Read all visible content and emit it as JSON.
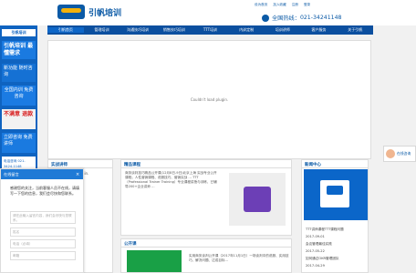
{
  "brand": {
    "logo_en": "SAILING",
    "logo_cn": "引帆培训"
  },
  "toplinks": [
    "设为首页",
    "加入收藏",
    "注册",
    "登录"
  ],
  "hotline": {
    "label": "全国热线：",
    "number": "021-34241148"
  },
  "nav": {
    "items": [
      "引帆首页",
      "管理培训",
      "沟通技巧培训",
      "销售技巧培训",
      "TTT培训",
      "内训定制",
      "培训讲师",
      "客户服务",
      "关于引帆"
    ],
    "active_index": 0
  },
  "left_rail": {
    "title": "引帆培训",
    "a": "引帆培训 最懂需求",
    "b": "新功能 随时咨询",
    "c": "全国内训 免费咨询",
    "d": "不满意 退款",
    "e": "立即咨询 免费讲师",
    "f": "电话咨询 021-3424-1148"
  },
  "main_plugin": {
    "message": "Couldn't load plugin."
  },
  "panels": {
    "p1": {
      "title": "实战讲师",
      "text": "Couldn't load plugin."
    },
    "p2": {
      "title": "精品课程",
      "text": "商务谈判技巧精品公开课(12月8日-9日)北京上海  实战专业公开课程；人性营销课程、说服技巧、营销实战 …  TTT（Professional Trainer Training）专业课程讲授与训练，已辅导200+企业讲师 …"
    },
    "p3": {
      "title": "公开课",
      "text": "实用商务谈判公开课（2017年11月1日）一场谈判中的说服、实用技巧、解决问题、达成目标…"
    },
    "p4": {
      "title": "新闻中心",
      "list": [
        "TTT讲师课程TTT课程问题",
        "2017-09-01",
        "会议管理最佳实践",
        "2017-05-22",
        "如何通过OKR管理团队",
        "2017-04-29"
      ]
    }
  },
  "chat": {
    "header": "在线留言",
    "message": "感谢您的关注，当前客服人员不在线，请填写一下您的信息，我们会尽快和您联系。",
    "input_placeholder": "请在此输入留言内容，我们会尽快与您联系。",
    "field_name": "姓名",
    "field_phone": "电话（必填）",
    "field_email": "邮箱",
    "close": "×"
  },
  "side_online": {
    "label": "在线咨询"
  }
}
